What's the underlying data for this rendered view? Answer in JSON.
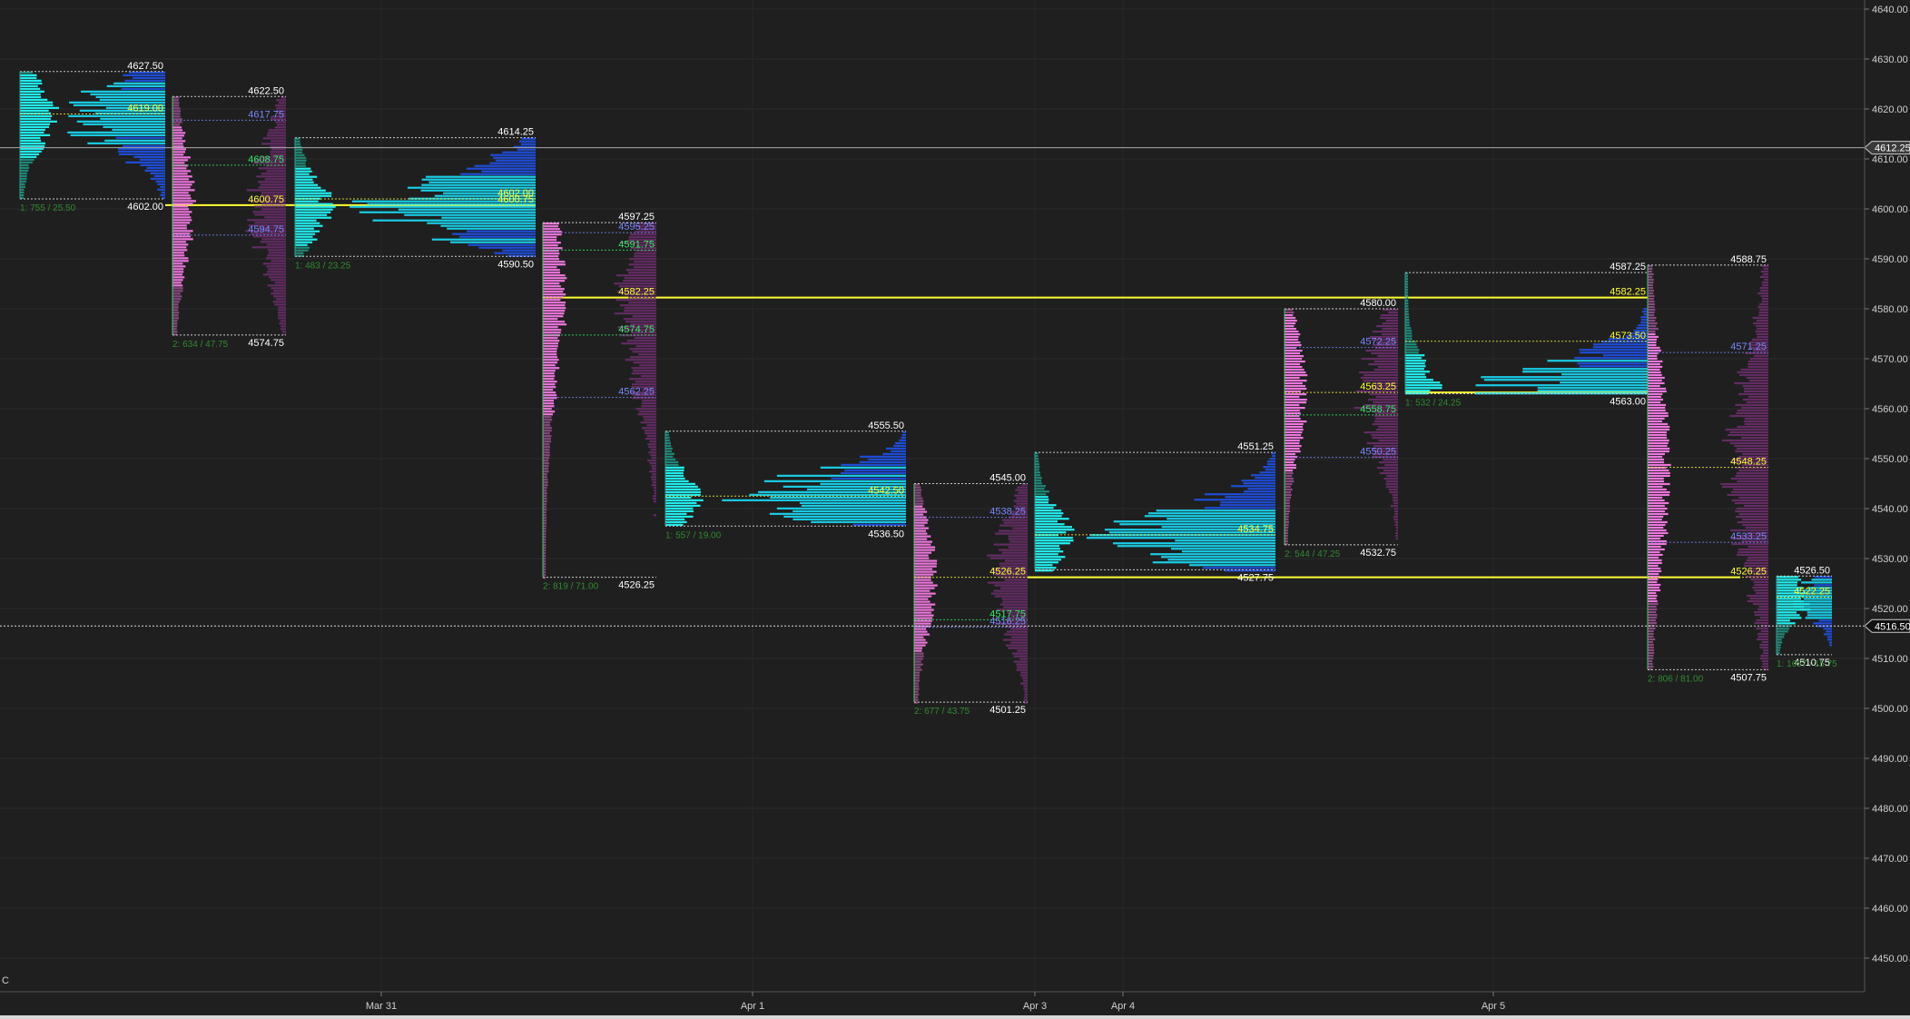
{
  "theme": {
    "background": "#1f1f1f",
    "grid": "#2b2b2b",
    "axis_text": "#cfcfcf",
    "label_white": "#ffffff",
    "label_yellow": "#ffff33",
    "label_green": "#33ee66",
    "label_blue": "#7788ff",
    "stats_green": "#2e8b2e",
    "tpo_teal": "#1e8a78",
    "tpo_cyan": "#22f0f0",
    "tpo_pink": "#ee77dd",
    "vol_cyan": "#19d6f0",
    "vol_blue": "#1f4fe0",
    "vol_purple": "#6a2d6a"
  },
  "axis": {
    "y_min": 4440,
    "y_max": 4640,
    "y_ticks": [
      "4640.00",
      "4630.00",
      "4620.00",
      "4610.00",
      "4600.00",
      "4590.00",
      "4580.00",
      "4570.00",
      "4560.00",
      "4550.00",
      "4540.00",
      "4530.00",
      "4520.00",
      "4510.00",
      "4500.00",
      "4490.00",
      "4480.00",
      "4470.00",
      "4460.00",
      "4450.00"
    ],
    "x_labels": [
      "Mar 31",
      "Apr 1",
      "Apr 3",
      "Apr 4",
      "Apr 5"
    ],
    "corner_label": "C",
    "price_markers": [
      {
        "price": "4612.25",
        "style": "solid"
      },
      {
        "price": "4516.50",
        "style": "dotted"
      }
    ]
  },
  "chart_data": {
    "type": "market-profile",
    "y_axis": {
      "range": [
        4440,
        4640
      ],
      "units": "price"
    },
    "x_axis": {
      "tick_labels": [
        "Mar 31",
        "Apr 1",
        "Apr 3",
        "Apr 4",
        "Apr 5"
      ]
    },
    "grid": true,
    "current_price": 4516.5,
    "crosshair_price": 4612.25,
    "sessions": [
      {
        "id": "s1",
        "tpo": "teal-cyan",
        "high": 4627.5,
        "low": 4602.0,
        "poc": 4619.0,
        "labels": [
          {
            "text": "4627.50",
            "color": "white",
            "pos": "top"
          },
          {
            "text": "4619.00",
            "color": "yellow",
            "pos": "poc"
          },
          {
            "text": "4602.00",
            "color": "white",
            "pos": "bottom"
          }
        ],
        "stats": "1: 755 / 25.50"
      },
      {
        "id": "s2",
        "tpo": "pink",
        "high": 4622.5,
        "low": 4574.75,
        "poc": 4600.75,
        "labels": [
          {
            "text": "4622.50",
            "color": "white",
            "pos": "top"
          },
          {
            "text": "4617.75",
            "color": "blue"
          },
          {
            "text": "4608.75",
            "color": "green"
          },
          {
            "text": "4600.75",
            "color": "yellow"
          },
          {
            "text": "4594.75",
            "color": "blue"
          },
          {
            "text": "4574.75",
            "color": "white",
            "pos": "bottom"
          }
        ],
        "stats": "2: 634 / 47.75"
      },
      {
        "id": "s3",
        "tpo": "teal-cyan",
        "high": 4614.25,
        "low": 4590.5,
        "poc": 4600.75,
        "labels": [
          {
            "text": "4614.25",
            "color": "white",
            "pos": "top"
          },
          {
            "text": "4602.00",
            "color": "yellow"
          },
          {
            "text": "4600.75",
            "color": "yellow"
          },
          {
            "text": "4590.50",
            "color": "white",
            "pos": "bottom"
          }
        ],
        "stats": "1: 483 / 23.25"
      },
      {
        "id": "s4",
        "tpo": "pink",
        "high": 4597.25,
        "low": 4526.25,
        "poc": 4582.25,
        "labels": [
          {
            "text": "4597.25",
            "color": "white",
            "pos": "top"
          },
          {
            "text": "4595.25",
            "color": "blue"
          },
          {
            "text": "4591.75",
            "color": "green"
          },
          {
            "text": "4582.25",
            "color": "yellow"
          },
          {
            "text": "4574.75",
            "color": "green"
          },
          {
            "text": "4562.25",
            "color": "blue"
          },
          {
            "text": "4526.25",
            "color": "white",
            "pos": "bottom"
          }
        ],
        "stats": "2: 819 / 71.00"
      },
      {
        "id": "s5",
        "tpo": "teal-cyan",
        "high": 4555.5,
        "low": 4536.5,
        "poc": 4542.5,
        "labels": [
          {
            "text": "4555.50",
            "color": "white",
            "pos": "top"
          },
          {
            "text": "4542.50",
            "color": "yellow"
          },
          {
            "text": "4536.50",
            "color": "white",
            "pos": "bottom"
          }
        ],
        "stats": "1: 557 / 19.00"
      },
      {
        "id": "s6",
        "tpo": "pink",
        "high": 4545.0,
        "low": 4501.25,
        "poc": 4526.25,
        "labels": [
          {
            "text": "4545.00",
            "color": "white",
            "pos": "top"
          },
          {
            "text": "4538.25",
            "color": "blue"
          },
          {
            "text": "4526.25",
            "color": "yellow"
          },
          {
            "text": "4517.75",
            "color": "green"
          },
          {
            "text": "4516.25",
            "color": "blue"
          },
          {
            "text": "4501.25",
            "color": "white",
            "pos": "bottom"
          }
        ],
        "stats": "2: 677 / 43.75"
      },
      {
        "id": "s7",
        "tpo": "teal-cyan",
        "high": 4551.25,
        "low": 4527.75,
        "poc": 4534.75,
        "labels": [
          {
            "text": "4551.25",
            "color": "white",
            "pos": "top"
          },
          {
            "text": "4534.75",
            "color": "yellow"
          },
          {
            "text": "4527.75",
            "color": "white",
            "pos": "bottom"
          }
        ],
        "stats": ""
      },
      {
        "id": "s8",
        "tpo": "pink",
        "high": 4580.0,
        "low": 4532.75,
        "poc": 4563.25,
        "labels": [
          {
            "text": "4580.00",
            "color": "white",
            "pos": "top"
          },
          {
            "text": "4572.25",
            "color": "blue"
          },
          {
            "text": "4563.25",
            "color": "yellow"
          },
          {
            "text": "4558.75",
            "color": "green"
          },
          {
            "text": "4550.25",
            "color": "blue"
          },
          {
            "text": "4532.75",
            "color": "white",
            "pos": "bottom"
          }
        ],
        "stats": "2: 544 / 47.25"
      },
      {
        "id": "s9",
        "tpo": "teal-cyan",
        "high": 4587.25,
        "low": 4563.0,
        "poc": 4563.25,
        "labels": [
          {
            "text": "4587.25",
            "color": "white",
            "pos": "top"
          },
          {
            "text": "4582.25",
            "color": "yellow"
          },
          {
            "text": "4573.50",
            "color": "yellow"
          },
          {
            "text": "4563.00",
            "color": "white",
            "pos": "bottom"
          }
        ],
        "stats": "1: 532 / 24.25"
      },
      {
        "id": "s10",
        "tpo": "pink",
        "high": 4588.75,
        "low": 4507.75,
        "poc": 4548.25,
        "labels": [
          {
            "text": "4588.75",
            "color": "white",
            "pos": "top"
          },
          {
            "text": "4571.25",
            "color": "blue"
          },
          {
            "text": "4548.25",
            "color": "yellow"
          },
          {
            "text": "4533.25",
            "color": "blue"
          },
          {
            "text": "4526.25",
            "color": "yellow"
          },
          {
            "text": "4507.75",
            "color": "white",
            "pos": "bottom"
          }
        ],
        "stats": "2: 806 / 81.00"
      },
      {
        "id": "s11",
        "tpo": "teal-cyan",
        "high": 4526.5,
        "low": 4510.75,
        "poc": 4522.25,
        "labels": [
          {
            "text": "4526.50",
            "color": "white",
            "pos": "top"
          },
          {
            "text": "4522.25",
            "color": "yellow"
          },
          {
            "text": "4510.75",
            "color": "white",
            "pos": "bottom"
          }
        ],
        "stats": "1: 1657 / 15.75"
      }
    ],
    "naked_poc_lines": [
      {
        "price": 4600.75,
        "color": "yellow"
      },
      {
        "price": 4582.25,
        "color": "yellow"
      },
      {
        "price": 4526.25,
        "color": "yellow"
      },
      {
        "price": 4563.25,
        "color": "yellow"
      }
    ]
  }
}
